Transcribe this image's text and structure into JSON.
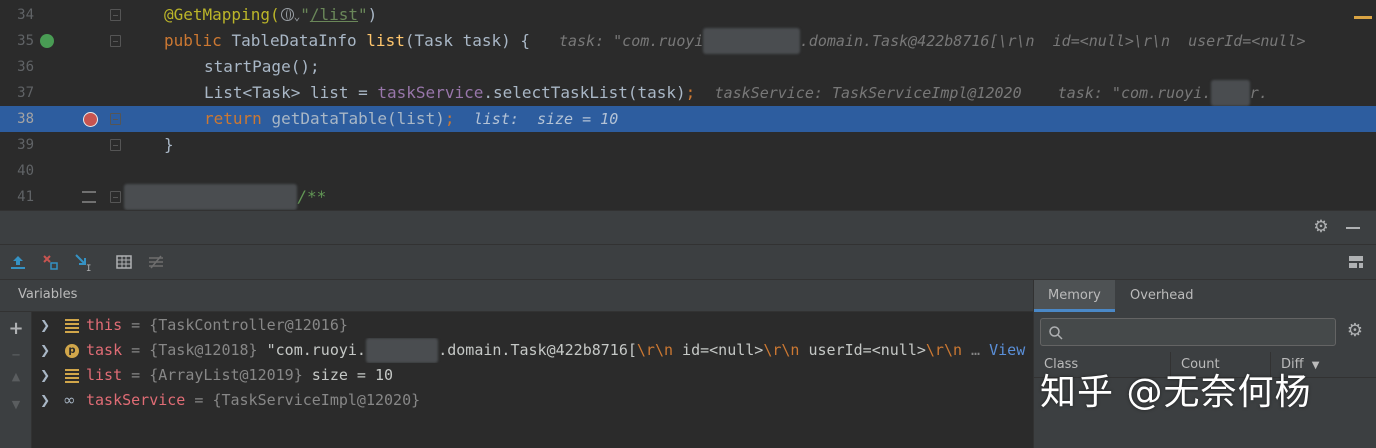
{
  "editor": {
    "lines": [
      {
        "num": "34",
        "parts": [
          {
            "t": "@GetMapping(",
            "c": "ann"
          },
          {
            "t": "\"",
            "c": "str"
          },
          {
            "t": "/list",
            "c": "str url"
          },
          {
            "t": "\"",
            "c": "str"
          },
          {
            "t": ")",
            "c": ""
          }
        ]
      },
      {
        "num": "35",
        "parts": [
          {
            "t": "public ",
            "c": "kw"
          },
          {
            "t": "TableDataInfo ",
            "c": ""
          },
          {
            "t": "list",
            "c": "fn"
          },
          {
            "t": "(Task task) {   ",
            "c": ""
          }
        ]
      },
      {
        "num": "36",
        "parts": [
          {
            "t": "startPage",
            "c": ""
          },
          {
            "t": "();",
            "c": ""
          }
        ]
      },
      {
        "num": "37",
        "parts": [
          {
            "t": "List<Task> list = ",
            "c": ""
          },
          {
            "t": "taskService",
            "c": "fld"
          },
          {
            "t": ".selectTaskList(task)",
            "c": ""
          },
          {
            "t": ";",
            "c": "kw"
          }
        ]
      },
      {
        "num": "38",
        "parts": [
          {
            "t": "return ",
            "c": "kw"
          },
          {
            "t": "getDataTable(list)",
            "c": ""
          },
          {
            "t": ";",
            "c": "kw"
          }
        ]
      },
      {
        "num": "39",
        "parts": [
          {
            "t": "}",
            "c": ""
          }
        ]
      },
      {
        "num": "40",
        "parts": []
      },
      {
        "num": "41",
        "parts": [
          {
            "t": "/**",
            "c": "cmt"
          }
        ]
      }
    ],
    "hints": {
      "line35_a": "task: \"com.ruoyi",
      "line35_b": ".domain.Task@422b8716[\\r\\n  id=<null>\\r\\n  userId=<null>",
      "line37_a": "taskService: TaskServiceImpl@12020",
      "line37_b": "task: \"com.ruoyi.",
      "line37_c": "r.",
      "line38": "list:  size = 10"
    }
  },
  "debugger": {
    "variables_title": "Variables",
    "variables": [
      {
        "name": "this",
        "icon": "field-icon",
        "parts": [
          {
            "t": " = ",
            "c": "vval"
          },
          {
            "t": "{TaskController@12016}",
            "c": "vval"
          }
        ]
      },
      {
        "name": "task",
        "icon": "parameter-icon",
        "parts": [
          {
            "t": " = ",
            "c": "vval"
          },
          {
            "t": "{Task@12018} ",
            "c": "vval"
          },
          {
            "t": "\"com.ruoyi.",
            "c": "vplain"
          },
          {
            "t": "BLUR",
            "c": "blur"
          },
          {
            "t": ".domain.Task@422b8716[",
            "c": "vplain"
          },
          {
            "t": "\\r\\n",
            "c": "vesc"
          },
          {
            "t": "  id=<null>",
            "c": "vplain"
          },
          {
            "t": "\\r\\n",
            "c": "vesc"
          },
          {
            "t": "  userId=<null>",
            "c": "vplain"
          },
          {
            "t": "\\r\\n",
            "c": "vesc"
          },
          {
            "t": " … ",
            "c": "vval"
          },
          {
            "t": "View",
            "c": "vlink"
          }
        ]
      },
      {
        "name": "list",
        "icon": "field-icon",
        "parts": [
          {
            "t": " = ",
            "c": "vval"
          },
          {
            "t": "{ArrayList@12019}",
            "c": "vval"
          },
          {
            "t": "  size = 10",
            "c": "vplain"
          }
        ]
      },
      {
        "name": "taskService",
        "icon": "watch-icon",
        "parts": [
          {
            "t": " = ",
            "c": "vval"
          },
          {
            "t": "{TaskServiceImpl@12020}",
            "c": "vval"
          }
        ]
      }
    ]
  },
  "memory": {
    "tabs": [
      "Memory",
      "Overhead"
    ],
    "columns": [
      "Class",
      "Count",
      "Diff"
    ]
  },
  "watermark": "知乎 @无奈何杨",
  "colors": {
    "current_line": "#2d5d9f",
    "breakpoint": "#c75450",
    "accent": "#4a88c7"
  }
}
